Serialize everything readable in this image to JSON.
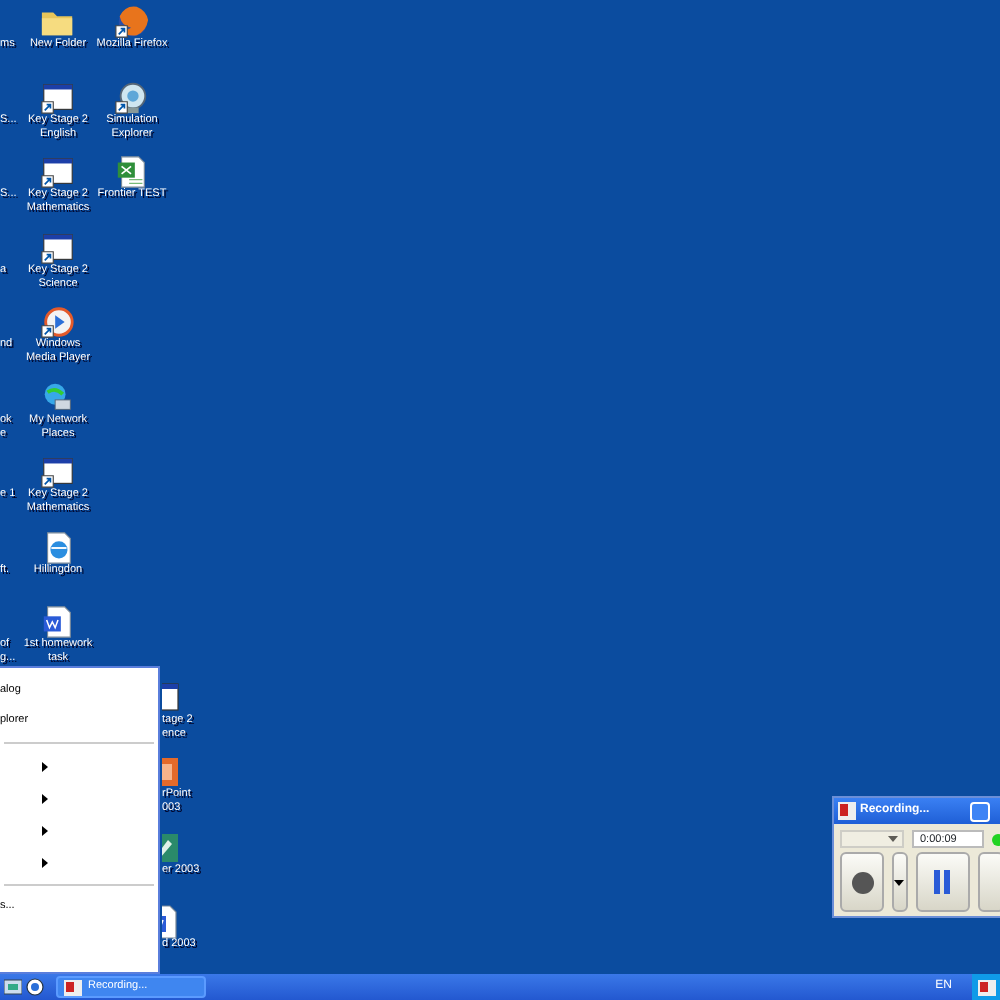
{
  "desktop": {
    "icon_columns": [
      [
        {
          "kind": "cut",
          "label": [
            "ms"
          ]
        },
        {
          "kind": "cut",
          "label": [
            "S..."
          ]
        },
        {
          "kind": "cut",
          "label": [
            "S..."
          ]
        },
        {
          "kind": "cut",
          "label": [
            "a"
          ]
        },
        {
          "kind": "cut",
          "label": [
            "nd"
          ]
        },
        {
          "kind": "cut",
          "label": [
            "ok",
            "e"
          ]
        },
        {
          "kind": "cut",
          "label": [
            "e 1"
          ]
        },
        {
          "kind": "cut",
          "label": [
            "ft."
          ]
        },
        {
          "kind": "cut",
          "label": [
            "of",
            "g..."
          ]
        }
      ],
      [
        {
          "kind": "folder",
          "label": [
            "New Folder"
          ]
        },
        {
          "kind": "program",
          "label": [
            "Key Stage 2",
            "English"
          ]
        },
        {
          "kind": "program",
          "label": [
            "Key Stage 2",
            "Mathematics"
          ]
        },
        {
          "kind": "program",
          "label": [
            "Key Stage 2",
            "Science"
          ]
        },
        {
          "kind": "media",
          "label": [
            "Windows",
            "Media Player"
          ]
        },
        {
          "kind": "network",
          "label": [
            "My Network",
            "Places"
          ]
        },
        {
          "kind": "program",
          "label": [
            "Key Stage 2",
            "Mathematics"
          ]
        },
        {
          "kind": "webpage",
          "label": [
            "Hillingdon"
          ]
        },
        {
          "kind": "document",
          "label": [
            "1st homework",
            "task"
          ]
        },
        {
          "kind": "program",
          "covered": true,
          "label": [
            "tage 2",
            "ence"
          ]
        },
        {
          "kind": "slides",
          "covered": true,
          "label": [
            "rPoint",
            "003"
          ]
        },
        {
          "kind": "publisher",
          "covered": true,
          "label": [
            "er 2003"
          ]
        },
        {
          "kind": "document",
          "covered": true,
          "label": [
            "d 2003"
          ]
        }
      ],
      [
        {
          "kind": "browser",
          "label": [
            "Mozilla Firefox"
          ]
        },
        {
          "kind": "simulation",
          "label": [
            "Simulation",
            "Explorer"
          ]
        },
        {
          "kind": "spreadsheet",
          "label": [
            "Frontier TEST"
          ]
        }
      ]
    ]
  },
  "start_menu": {
    "items": [
      {
        "kind": "item",
        "label": "alog"
      },
      {
        "kind": "item",
        "label": "plorer"
      },
      {
        "kind": "separator"
      },
      {
        "kind": "submenu"
      },
      {
        "kind": "submenu"
      },
      {
        "kind": "submenu"
      },
      {
        "kind": "submenu"
      },
      {
        "kind": "separator"
      },
      {
        "kind": "item",
        "label": "s..."
      }
    ]
  },
  "recorder": {
    "title": "Recording...",
    "source_dropdown": {
      "disabled": true
    },
    "time": "0:00:09",
    "recording_light": {
      "on": true
    }
  },
  "taskbar": {
    "tasks": [
      {
        "label": "Recording...",
        "selected": false
      }
    ],
    "language": "EN"
  }
}
